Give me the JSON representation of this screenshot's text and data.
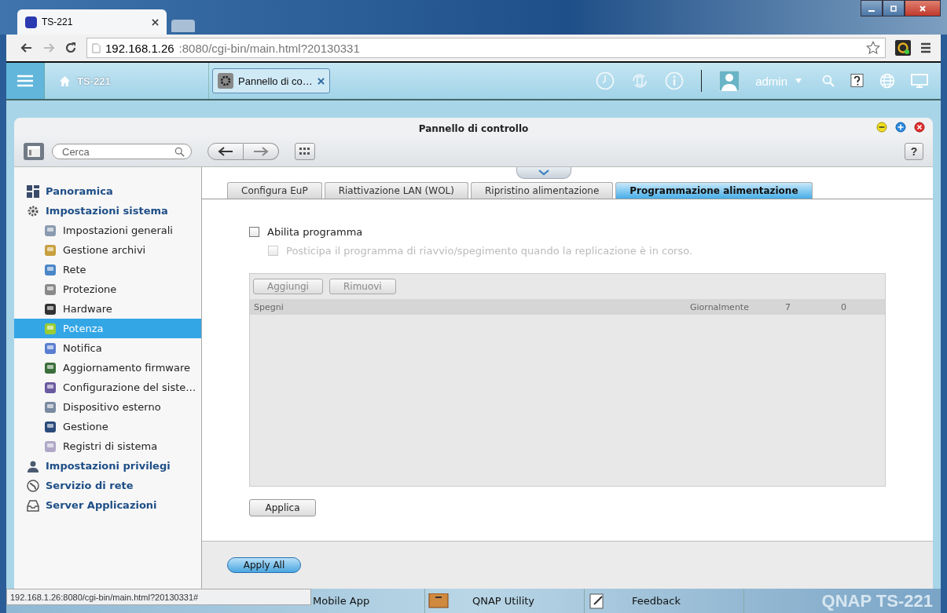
{
  "browser": {
    "tab_title": "TS-221",
    "url_host": "192.168.1.26",
    "url_rest": ":8080/cgi-bin/main.html?20130331"
  },
  "top_bar": {
    "home_label": "TS-221",
    "app_tab": "Pannello di co…",
    "user": "admin"
  },
  "window": {
    "title": "Pannello di controllo",
    "search_placeholder": "Cerca",
    "help_label": "?"
  },
  "sidebar": [
    {
      "label": "Panoramica",
      "selected": false
    },
    {
      "label": "Impostazioni sistema",
      "selected": false,
      "children": [
        {
          "label": "Impostazioni generali",
          "selected": false
        },
        {
          "label": "Gestione archivi",
          "selected": false
        },
        {
          "label": "Rete",
          "selected": false
        },
        {
          "label": "Protezione",
          "selected": false
        },
        {
          "label": "Hardware",
          "selected": false
        },
        {
          "label": "Potenza",
          "selected": true
        },
        {
          "label": "Notifica",
          "selected": false
        },
        {
          "label": "Aggiornamento firmware",
          "selected": false
        },
        {
          "label": "Configurazione del siste…",
          "selected": false
        },
        {
          "label": "Dispositivo esterno",
          "selected": false
        },
        {
          "label": "Gestione",
          "selected": false
        },
        {
          "label": "Registri di sistema",
          "selected": false
        }
      ]
    },
    {
      "label": "Impostazioni privilegi",
      "selected": false
    },
    {
      "label": "Servizio di rete",
      "selected": false
    },
    {
      "label": "Server Applicazioni",
      "selected": false
    }
  ],
  "tabs": [
    {
      "label": "Configura EuP",
      "selected": false
    },
    {
      "label": "Riattivazione LAN (WOL)",
      "selected": false
    },
    {
      "label": "Ripristino alimentazione",
      "selected": false
    },
    {
      "label": "Programmazione alimentazione",
      "selected": true
    }
  ],
  "options": [
    {
      "label": "Abilita programma",
      "checked": false,
      "disabled": false
    },
    {
      "label": "Posticipa il programma di riavvio/spegimento quando la replicazione è in corso.",
      "checked": false,
      "disabled": true
    }
  ],
  "table": {
    "buttons": [
      {
        "label": "Aggiungi",
        "disabled": true
      },
      {
        "label": "Rimuovi",
        "disabled": true
      }
    ],
    "rows": [
      [
        "Spegni",
        "Giornalmente",
        "7",
        "0"
      ]
    ]
  },
  "apply": "Applica",
  "apply_all": "Apply All",
  "dock": [
    "Mobile App",
    "QNAP Utility",
    "Feedback"
  ],
  "dock_logo": "QNAP TS-221",
  "status_url": "192.168.1.26:8080/cgi-bin/main.html?20130331#"
}
